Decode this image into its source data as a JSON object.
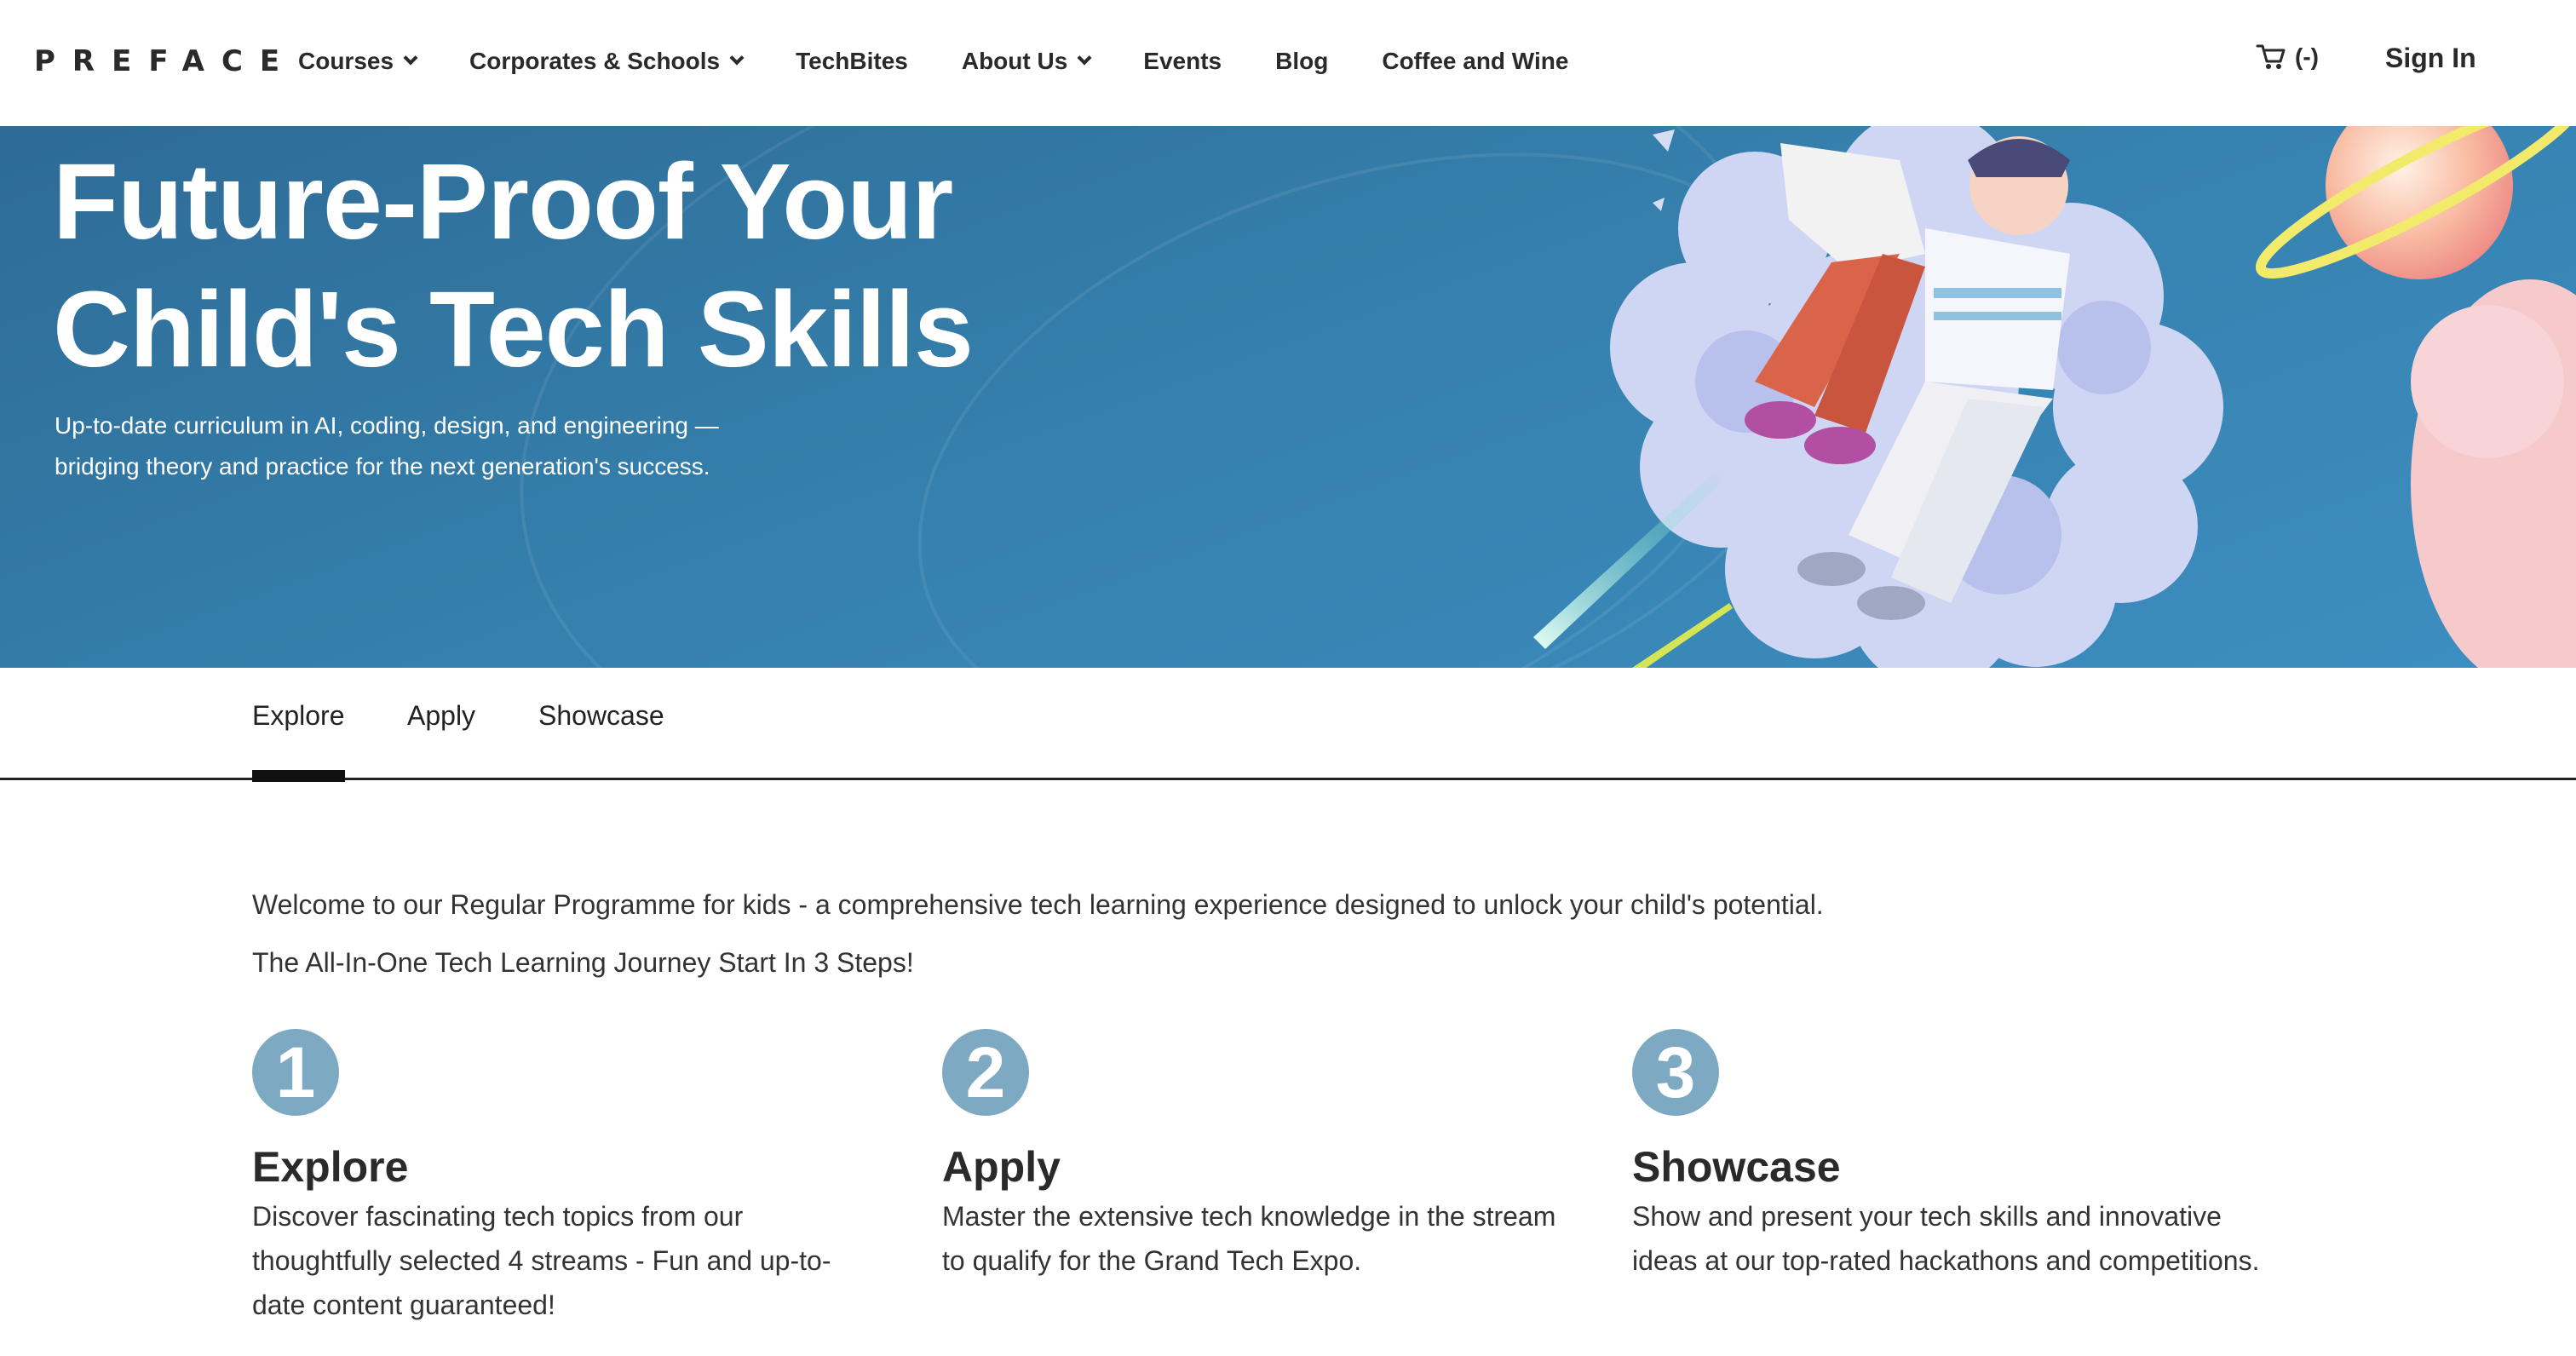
{
  "header": {
    "logo": "PREFACE",
    "nav": [
      {
        "label": "Courses",
        "dropdown": true
      },
      {
        "label": "Corporates & Schools",
        "dropdown": true
      },
      {
        "label": "TechBites",
        "dropdown": false
      },
      {
        "label": "About Us",
        "dropdown": true
      },
      {
        "label": "Events",
        "dropdown": false
      },
      {
        "label": "Blog",
        "dropdown": false
      },
      {
        "label": "Coffee and Wine",
        "dropdown": false
      }
    ],
    "cart_label": "(-)",
    "signin_label": "Sign In"
  },
  "hero": {
    "title_line1": "Future-Proof Your",
    "title_line2": "Child's Tech Skills",
    "subtitle_line1": "Up-to-date curriculum in AI, coding, design, and engineering —",
    "subtitle_line2": "bridging theory and practice for the next generation's success."
  },
  "tabs": [
    {
      "label": "Explore",
      "active": true
    },
    {
      "label": "Apply",
      "active": false
    },
    {
      "label": "Showcase",
      "active": false
    }
  ],
  "content": {
    "welcome": "Welcome to our Regular Programme for kids - a comprehensive tech learning experience designed to unlock your child's potential.",
    "journey": "The All-In-One Tech Learning Journey Start In 3 Steps!",
    "steps": [
      {
        "number": "1",
        "title": "Explore",
        "description": "Discover fascinating tech topics from our thoughtfully selected 4 streams - Fun and up-to-date content guaranteed!"
      },
      {
        "number": "2",
        "title": "Apply",
        "description": "Master the extensive tech knowledge in the stream to qualify for the Grand Tech Expo."
      },
      {
        "number": "3",
        "title": "Showcase",
        "description": "Show and present your tech skills and innovative ideas at our top-rated hackathons and competitions."
      }
    ]
  },
  "colors": {
    "hero_bg": "#357fac",
    "step_badge": "#7ea9c2",
    "text_dark": "#2a2a2a"
  }
}
